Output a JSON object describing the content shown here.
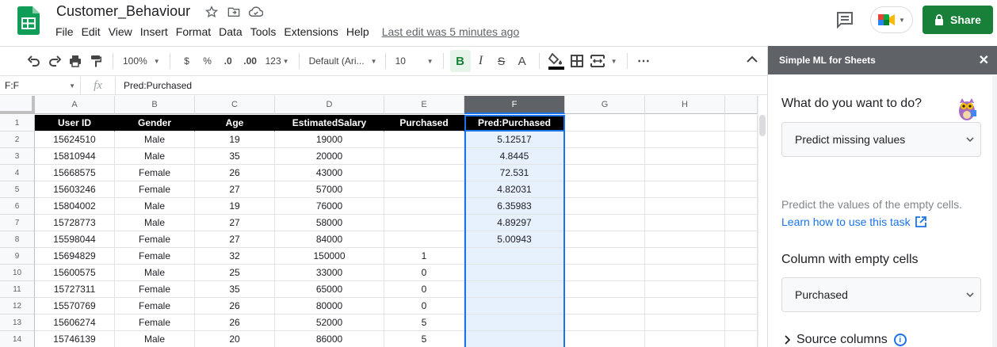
{
  "doc": {
    "title": "Customer_Behaviour",
    "menu": [
      "File",
      "Edit",
      "View",
      "Insert",
      "Format",
      "Data",
      "Tools",
      "Extensions",
      "Help"
    ],
    "last_edit": "Last edit was 5 minutes ago"
  },
  "header": {
    "share_label": "Share"
  },
  "toolbar": {
    "zoom": "100%",
    "currency": "$",
    "percent": "%",
    "dec_decrease": ".0",
    "dec_increase": ".00",
    "more_formats": "123",
    "font": "Default (Ari...",
    "font_size": "10",
    "bold": "B",
    "italic": "I",
    "strike": "S",
    "text_color": "A"
  },
  "formula_bar": {
    "name_box": "F:F",
    "fx": "fx",
    "value": "Pred:Purchased"
  },
  "grid": {
    "columns": [
      "A",
      "B",
      "C",
      "D",
      "E",
      "F",
      "G",
      "H"
    ],
    "row_numbers": [
      "1",
      "2",
      "3",
      "4",
      "5",
      "6",
      "7",
      "8",
      "9",
      "10",
      "11",
      "12",
      "13",
      "14"
    ],
    "headers": [
      "User ID",
      "Gender",
      "Age",
      "EstimatedSalary",
      "Purchased",
      "Pred:Purchased"
    ],
    "rows": [
      [
        "15624510",
        "Male",
        "19",
        "19000",
        "",
        "5.12517"
      ],
      [
        "15810944",
        "Male",
        "35",
        "20000",
        "",
        "4.8445"
      ],
      [
        "15668575",
        "Female",
        "26",
        "43000",
        "",
        "72.531"
      ],
      [
        "15603246",
        "Female",
        "27",
        "57000",
        "",
        "4.82031"
      ],
      [
        "15804002",
        "Male",
        "19",
        "76000",
        "",
        "6.35983"
      ],
      [
        "15728773",
        "Male",
        "27",
        "58000",
        "",
        "4.89297"
      ],
      [
        "15598044",
        "Female",
        "27",
        "84000",
        "",
        "5.00943"
      ],
      [
        "15694829",
        "Female",
        "32",
        "150000",
        "1",
        ""
      ],
      [
        "15600575",
        "Male",
        "25",
        "33000",
        "0",
        ""
      ],
      [
        "15727311",
        "Female",
        "35",
        "65000",
        "0",
        ""
      ],
      [
        "15570769",
        "Female",
        "26",
        "80000",
        "0",
        ""
      ],
      [
        "15606274",
        "Female",
        "26",
        "52000",
        "5",
        ""
      ],
      [
        "15746139",
        "Male",
        "20",
        "86000",
        "5",
        ""
      ]
    ]
  },
  "panel": {
    "title": "Simple ML for Sheets",
    "question1": "What do you want to do?",
    "task_select": "Predict missing values",
    "description": "Predict the values of the empty cells.",
    "learn_link": "Learn how to use this task",
    "question2": "Column with empty cells",
    "column_select": "Purchased",
    "source_columns": "Source columns"
  },
  "colors": {
    "share_green": "#188038",
    "selection_blue": "#1a73e8",
    "selected_fill": "#e7f0fd",
    "header_black": "#000000",
    "panel_header": "#5f6368"
  }
}
